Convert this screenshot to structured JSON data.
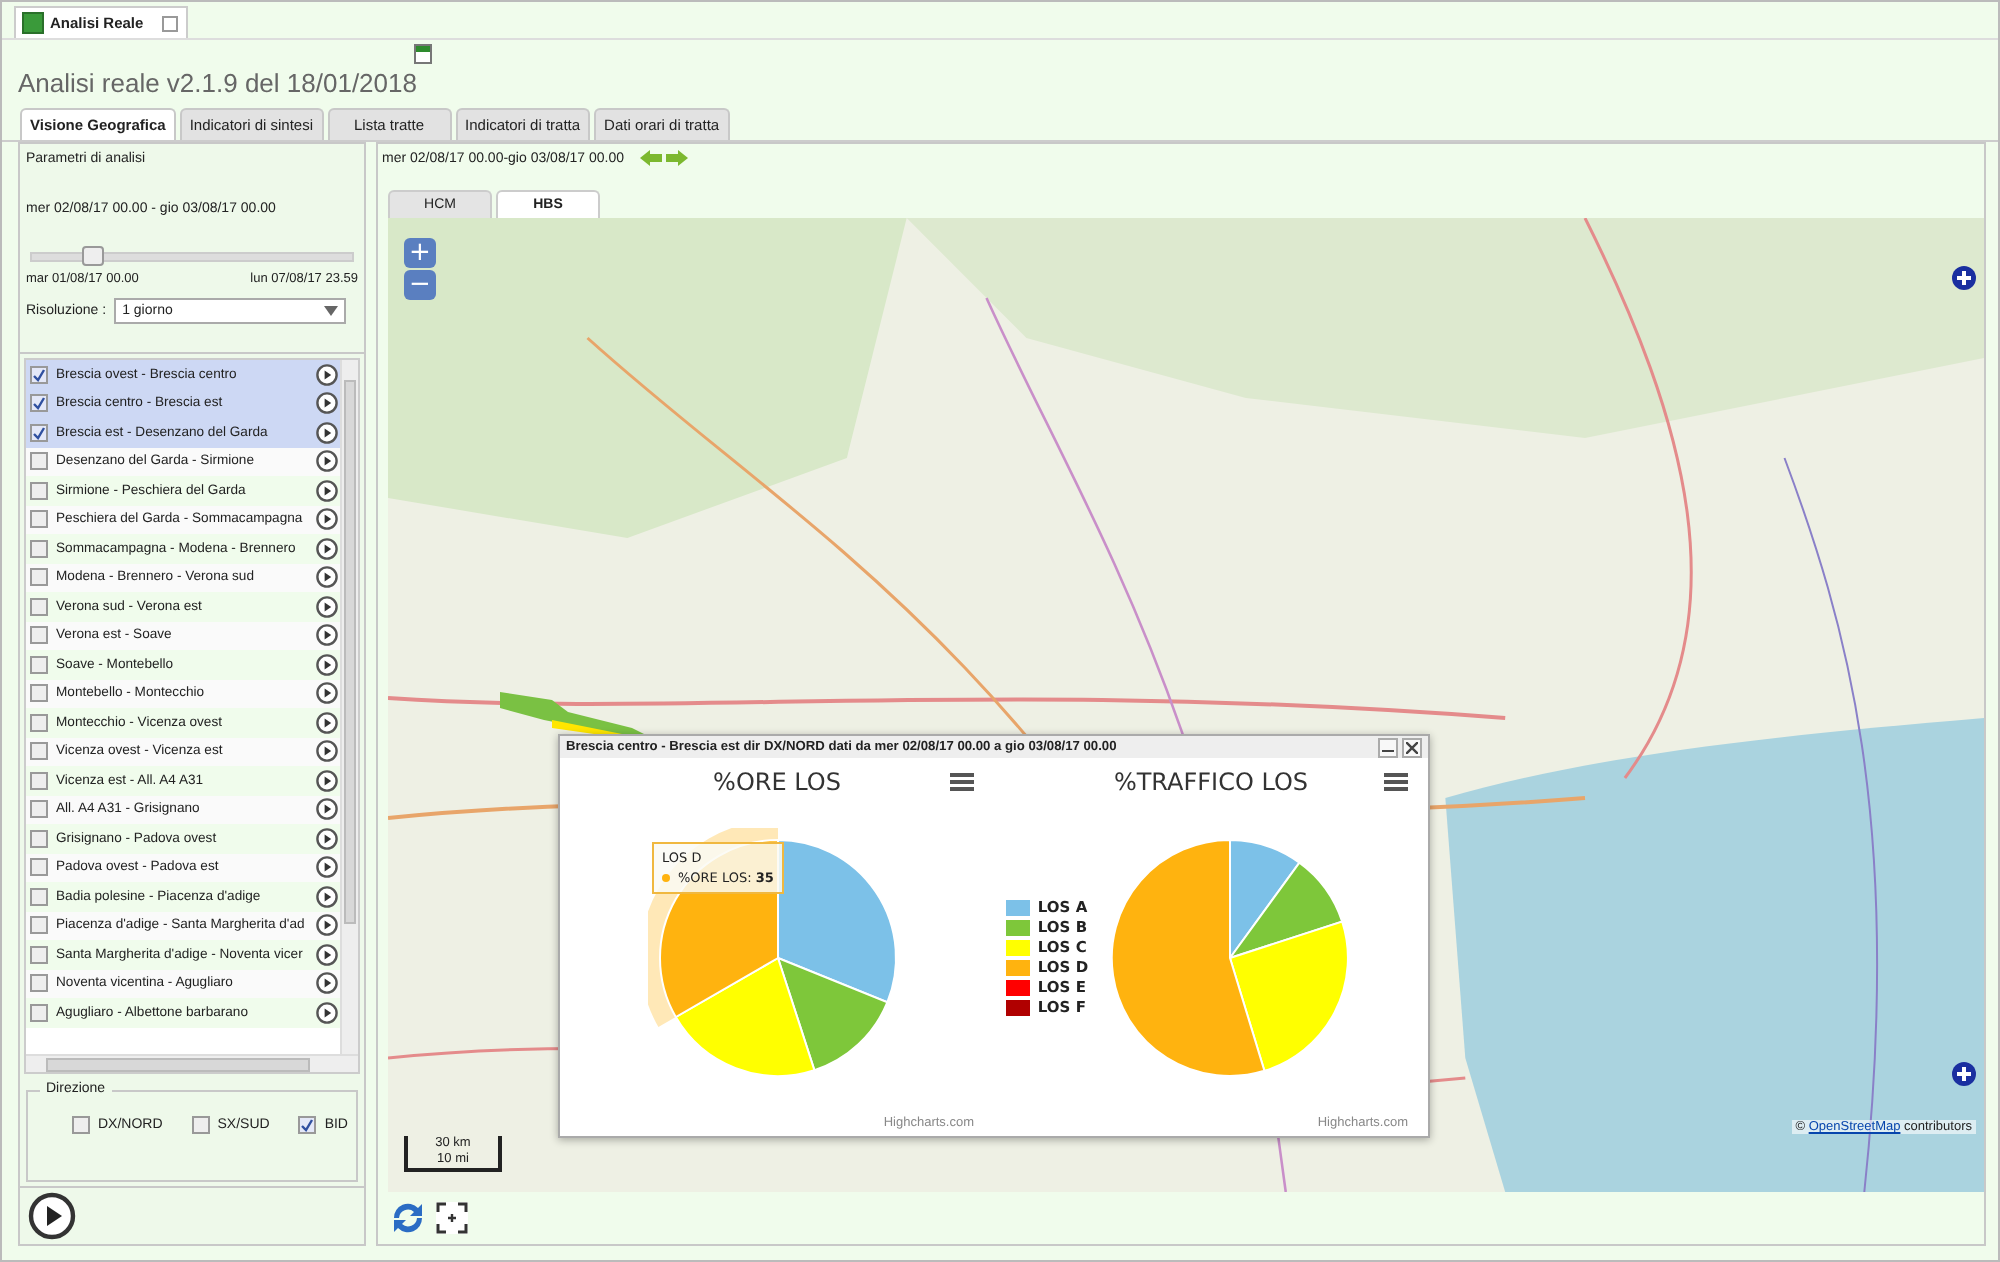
{
  "document_tab": {
    "label": "Analisi Reale"
  },
  "title": "Analisi reale v2.1.9 del 18/01/2018",
  "tabs": [
    {
      "label": "Visione Geografica",
      "selected": true
    },
    {
      "label": "Indicatori di sintesi",
      "selected": false
    },
    {
      "label": "Lista tratte",
      "selected": false
    },
    {
      "label": "Indicatori di tratta",
      "selected": false
    },
    {
      "label": "Dati orari di tratta",
      "selected": false
    }
  ],
  "parameters": {
    "heading": "Parametri di analisi",
    "range": "mer 02/08/17 00.00 - gio 03/08/17 00.00",
    "slider": {
      "level": 0.19,
      "start": "mar 01/08/17 00.00",
      "end": "lun 07/08/17 23.59"
    },
    "resolution_label": "Risoluzione :",
    "resolution": "1 giorno"
  },
  "segments": [
    {
      "label": "Brescia ovest - Brescia centro",
      "checked": true,
      "selected": true
    },
    {
      "label": "Brescia centro - Brescia est",
      "checked": true,
      "selected": true
    },
    {
      "label": "Brescia est - Desenzano del Garda",
      "checked": true,
      "selected": true
    },
    {
      "label": "Desenzano del Garda - Sirmione",
      "checked": false,
      "selected": false
    },
    {
      "label": "Sirmione - Peschiera del Garda",
      "checked": false,
      "selected": false
    },
    {
      "label": "Peschiera del Garda - Sommacampagna",
      "checked": false,
      "selected": false
    },
    {
      "label": "Sommacampagna - Modena - Brennero",
      "checked": false,
      "selected": false
    },
    {
      "label": "Modena - Brennero - Verona sud",
      "checked": false,
      "selected": false
    },
    {
      "label": "Verona sud - Verona est",
      "checked": false,
      "selected": false
    },
    {
      "label": "Verona est - Soave",
      "checked": false,
      "selected": false
    },
    {
      "label": "Soave - Montebello",
      "checked": false,
      "selected": false
    },
    {
      "label": "Montebello - Montecchio",
      "checked": false,
      "selected": false
    },
    {
      "label": "Montecchio - Vicenza ovest",
      "checked": false,
      "selected": false
    },
    {
      "label": "Vicenza ovest - Vicenza est",
      "checked": false,
      "selected": false
    },
    {
      "label": "Vicenza est - All. A4 A31",
      "checked": false,
      "selected": false
    },
    {
      "label": "All. A4 A31 - Grisignano",
      "checked": false,
      "selected": false
    },
    {
      "label": "Grisignano - Padova ovest",
      "checked": false,
      "selected": false
    },
    {
      "label": "Padova ovest - Padova est",
      "checked": false,
      "selected": false
    },
    {
      "label": "Badia polesine - Piacenza d'adige",
      "checked": false,
      "selected": false
    },
    {
      "label": "Piacenza d'adige - Santa Margherita d'ad",
      "checked": false,
      "selected": false
    },
    {
      "label": "Santa Margherita d'adige - Noventa vicer",
      "checked": false,
      "selected": false
    },
    {
      "label": "Noventa vicentina - Agugliaro",
      "checked": false,
      "selected": false
    },
    {
      "label": "Agugliaro - Albettone barbarano",
      "checked": false,
      "selected": false
    }
  ],
  "direction": {
    "legend": "Direzione",
    "options": [
      {
        "label": "DX/NORD",
        "checked": false
      },
      {
        "label": "SX/SUD",
        "checked": false
      },
      {
        "label": "BID",
        "checked": true
      }
    ]
  },
  "map_header": {
    "range": "mer 02/08/17 00.00-gio 03/08/17 00.00"
  },
  "map_tabs": [
    {
      "label": "HCM",
      "selected": false
    },
    {
      "label": "HBS",
      "selected": true
    }
  ],
  "map": {
    "zoom_in": "+",
    "zoom_out": "−",
    "scale_km": "30 km",
    "scale_mi": "10 mi",
    "attribution_prefix": "©",
    "attribution_link": "OpenStreetMap",
    "attribution_suffix": "contributors"
  },
  "popup": {
    "title": "Brescia centro - Brescia est dir DX/NORD dati da mer 02/08/17 00.00 a gio 03/08/17 00.00",
    "charts": [
      {
        "title": "%ORE LOS",
        "credits": "Highcharts.com",
        "tooltip": {
          "label": "LOS D",
          "text": "%ORE LOS: **35**"
        }
      },
      {
        "title": "%TRAFFICO LOS",
        "credits": "Highcharts.com"
      }
    ],
    "legend": [
      {
        "label": "LOS A",
        "color": "#7cc1e8"
      },
      {
        "label": "LOS B",
        "color": "#7ec73a"
      },
      {
        "label": "LOS C",
        "color": "#ffff00"
      },
      {
        "label": "LOS D",
        "color": "#ffb30f"
      },
      {
        "label": "LOS E",
        "color": "#ff0000"
      },
      {
        "label": "LOS F",
        "color": "#b00000"
      }
    ]
  }
}
